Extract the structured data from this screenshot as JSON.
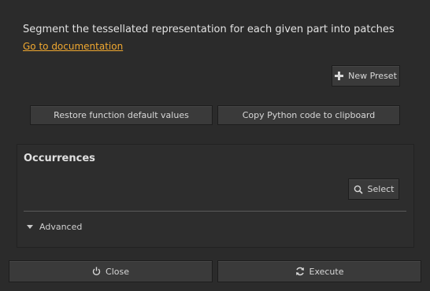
{
  "header": {
    "description": "Segment the tessellated representation for each given part into patches",
    "doc_link": "Go to documentation"
  },
  "toolbar": {
    "new_preset_label": "New Preset",
    "new_preset_icon": "plus-icon",
    "restore_label": "Restore function default values",
    "copy_python_label": "Copy Python code to clipboard"
  },
  "occurrences": {
    "title": "Occurrences",
    "select_label": "Select",
    "select_icon": "magnifier-icon"
  },
  "advanced": {
    "label": "Advanced",
    "icon": "triangle-down-icon"
  },
  "footer": {
    "close_label": "Close",
    "close_icon": "power-icon",
    "execute_label": "Execute",
    "execute_icon": "refresh-icon"
  },
  "colors": {
    "background": "#2b2b2b",
    "link": "#f0a830",
    "button": "#3a3a3a"
  }
}
